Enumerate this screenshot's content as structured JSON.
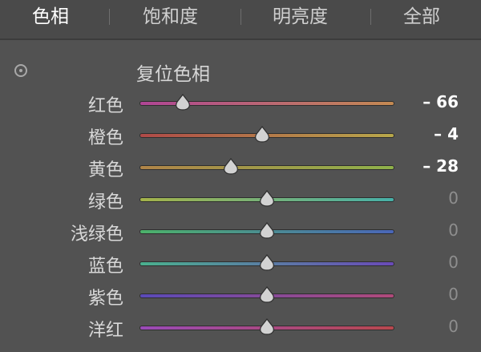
{
  "tabs": [
    {
      "label": "色相",
      "active": true
    },
    {
      "label": "饱和度",
      "active": false
    },
    {
      "label": "明亮度",
      "active": false
    },
    {
      "label": "全部",
      "active": false
    }
  ],
  "reset": {
    "label": "复位色相",
    "icon": "target-adjust-icon"
  },
  "sliders": [
    {
      "label": "红色",
      "value": -66,
      "value_text": "– 66",
      "gradient": [
        "#b04595",
        "#c48a52"
      ]
    },
    {
      "label": "橙色",
      "value": -4,
      "value_text": "– 4",
      "gradient": [
        "#b04a48",
        "#b8a84a"
      ]
    },
    {
      "label": "黄色",
      "value": -28,
      "value_text": "– 28",
      "gradient": [
        "#b08448",
        "#8fb24a"
      ]
    },
    {
      "label": "绿色",
      "value": 0,
      "value_text": "0",
      "gradient": [
        "#a4b24a",
        "#47b0a8"
      ]
    },
    {
      "label": "浅绿色",
      "value": 0,
      "value_text": "0",
      "gradient": [
        "#4cb26a",
        "#4a66b8"
      ]
    },
    {
      "label": "蓝色",
      "value": 0,
      "value_text": "0",
      "gradient": [
        "#4ab08e",
        "#6a4ab8"
      ]
    },
    {
      "label": "紫色",
      "value": 0,
      "value_text": "0",
      "gradient": [
        "#5a4ab8",
        "#b04a7a"
      ]
    },
    {
      "label": "洋红",
      "value": 0,
      "value_text": "0",
      "gradient": [
        "#9a4ab8",
        "#b8484e"
      ]
    }
  ],
  "range": [
    -100,
    100
  ]
}
